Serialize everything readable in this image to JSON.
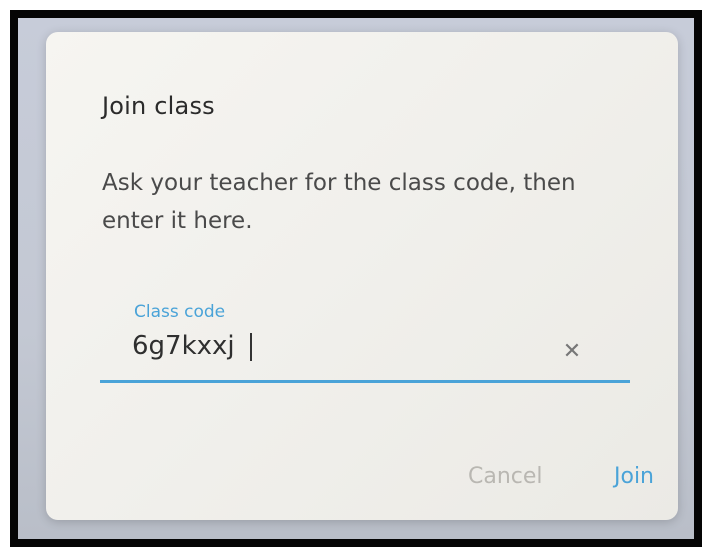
{
  "dialog": {
    "title": "Join class",
    "description": "Ask your teacher for the class code, then enter it here.",
    "field": {
      "label": "Class code",
      "value": "6g7kxxj",
      "clear_icon": "close-icon"
    },
    "buttons": {
      "cancel_label": "Cancel",
      "join_label": "Join"
    }
  },
  "colors": {
    "accent": "#4aa3d8",
    "cancel_text": "#b9b7b2",
    "title_text": "#2b2b2b"
  }
}
